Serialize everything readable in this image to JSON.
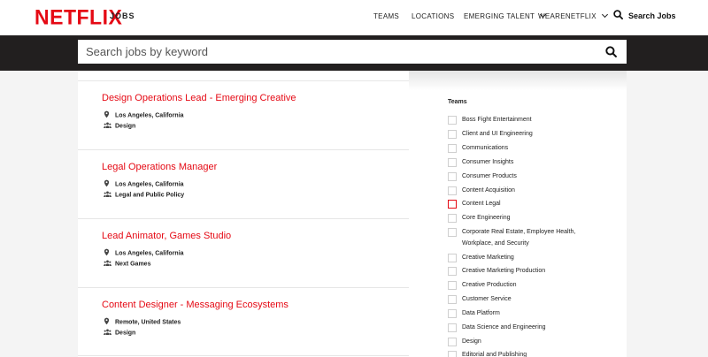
{
  "header": {
    "logo": "NETFLIX",
    "section": "JOBS",
    "nav": [
      {
        "label": "TEAMS",
        "dropdown": false
      },
      {
        "label": "LOCATIONS",
        "dropdown": false
      },
      {
        "label": "EMERGING TALENT",
        "dropdown": true
      },
      {
        "label": "WEARENETFLIX",
        "dropdown": true
      }
    ],
    "search_link": "Search Jobs"
  },
  "search": {
    "placeholder": "Search jobs by keyword"
  },
  "jobs": [
    {
      "title": "Design Operations Lead - Emerging Creative",
      "location": "Los Angeles, California",
      "team": "Design"
    },
    {
      "title": "Legal Operations Manager",
      "location": "Los Angeles, California",
      "team": "Legal and Public Policy"
    },
    {
      "title": "Lead Animator, Games Studio",
      "location": "Los Angeles, California",
      "team": "Next Games"
    },
    {
      "title": "Content Designer - Messaging Ecosystems",
      "location": "Remote, United States",
      "team": "Design"
    }
  ],
  "filters": {
    "heading": "Teams",
    "teams": [
      {
        "label": "Boss Fight Entertainment",
        "checked": false
      },
      {
        "label": "Client and UI Engineering",
        "checked": false
      },
      {
        "label": "Communications",
        "checked": false
      },
      {
        "label": "Consumer Insights",
        "checked": false
      },
      {
        "label": "Consumer Products",
        "checked": false
      },
      {
        "label": "Content Acquisition",
        "checked": false
      },
      {
        "label": "Content Legal",
        "checked": false,
        "focused": true
      },
      {
        "label": "Core Engineering",
        "checked": false
      },
      {
        "label": "Corporate Real Estate, Employee Health,",
        "label2": "Workplace, and Security",
        "checked": false
      },
      {
        "label": "Creative Marketing",
        "checked": false
      },
      {
        "label": "Creative Marketing Production",
        "checked": false
      },
      {
        "label": "Creative Production",
        "checked": false
      },
      {
        "label": "Customer Service",
        "checked": false
      },
      {
        "label": "Data Platform",
        "checked": false
      },
      {
        "label": "Data Science and Engineering",
        "checked": false
      },
      {
        "label": "Design",
        "checked": false
      },
      {
        "label": "Editorial and Publishing",
        "checked": false
      }
    ]
  },
  "colors": {
    "brand": "#e50914",
    "strip": "#221f1f",
    "page": "#f4f4f4"
  }
}
